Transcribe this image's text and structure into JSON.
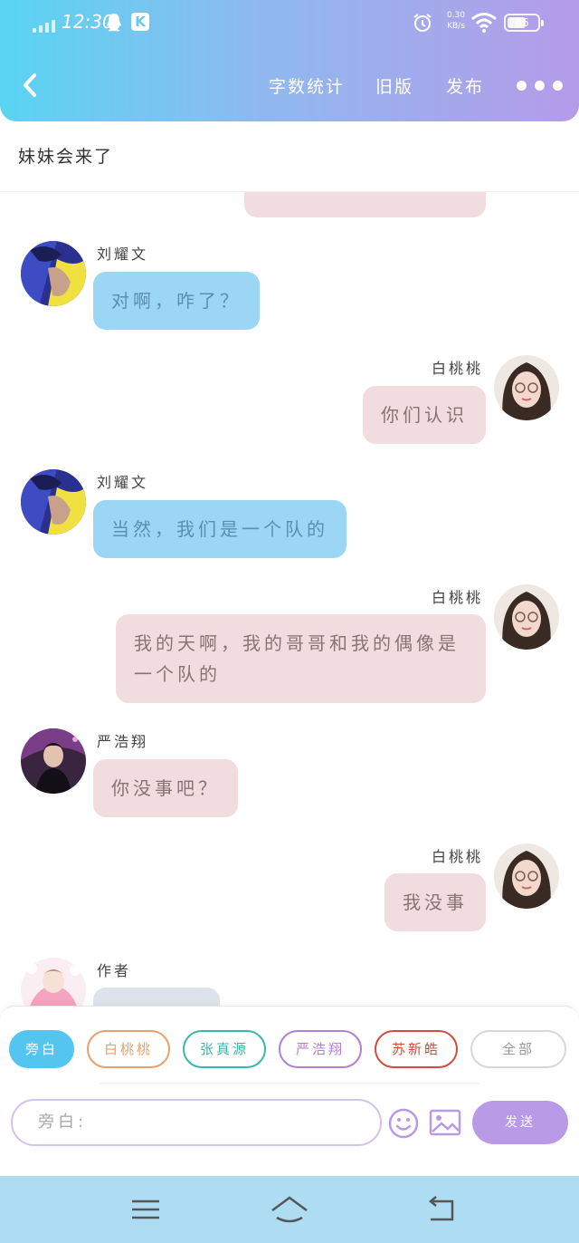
{
  "status": {
    "time": "12:30",
    "speed_value": "0.30",
    "speed_unit": "KB/s",
    "battery": "66"
  },
  "header": {
    "actions": [
      "字数统计",
      "旧版",
      "发布"
    ]
  },
  "story": {
    "title": "妹妹会来了"
  },
  "messages": [
    {
      "side": "right",
      "name": "",
      "text": "",
      "bubble_color": "pink"
    },
    {
      "side": "left",
      "name": "刘耀文",
      "text": "对啊，咋了？",
      "bubble_color": "blue"
    },
    {
      "side": "right",
      "name": "白桃桃",
      "text": "你们认识",
      "bubble_color": "pink"
    },
    {
      "side": "left",
      "name": "刘耀文",
      "text": "当然，我们是一个队的",
      "bubble_color": "blue"
    },
    {
      "side": "right",
      "name": "白桃桃",
      "text": "我的天啊，我的哥哥和我的偶像是一个队的",
      "bubble_color": "pink"
    },
    {
      "side": "left",
      "name": "严浩翔",
      "text": "你没事吧？",
      "bubble_color": "pink"
    },
    {
      "side": "right",
      "name": "白桃桃",
      "text": "我没事",
      "bubble_color": "pink"
    },
    {
      "side": "left",
      "name": "作者",
      "text": "",
      "bubble_color": "grey"
    }
  ],
  "compose": {
    "roles": [
      {
        "label": "旁白",
        "color": "#53c5ee",
        "filled": true
      },
      {
        "label": "白桃桃",
        "color": "#e9a06e",
        "filled": false
      },
      {
        "label": "张真源",
        "color": "#3bb7a6",
        "filled": false
      },
      {
        "label": "严浩翔",
        "color": "#b07fd8",
        "filled": false
      },
      {
        "label": "苏新皓",
        "color": "#d44b3c",
        "filled": false
      },
      {
        "label": "全部",
        "color": "#cccccc",
        "filled": false
      }
    ],
    "input_placeholder": "旁白:",
    "send_label": "发送"
  },
  "colors": {
    "gradient_start": "#59d4f2",
    "gradient_end": "#b59be9",
    "send": "#b99ae7"
  }
}
